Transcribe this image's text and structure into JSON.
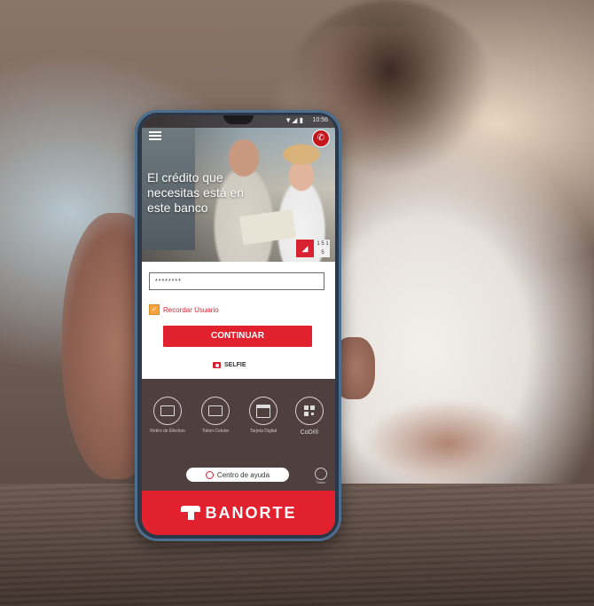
{
  "statusbar": {
    "time": "10:56",
    "signal": "▼◢ ▮"
  },
  "hero": {
    "headline": "El crédito que necesitas está en este banco",
    "badge_left": "◢",
    "badge_right": "1 5 1 5"
  },
  "login": {
    "username_value": "********",
    "remember_label": "Recordar Usuario",
    "remember_checked": true,
    "continue_label": "CONTINUAR",
    "selfie_label": "SELFIE"
  },
  "quick_actions": [
    {
      "label": "Retiro de Efectivo",
      "icon": "cash-withdraw-icon"
    },
    {
      "label": "Token Celular",
      "icon": "token-icon"
    },
    {
      "label": "Tarjeta Digital",
      "icon": "card-icon"
    },
    {
      "label": "CoDi®",
      "icon": "qr-code-icon"
    }
  ],
  "help_label": "Centro de ayuda",
  "token_corner_label": "Token",
  "brand": {
    "name": "BANORTE",
    "color": "#e2212f"
  }
}
